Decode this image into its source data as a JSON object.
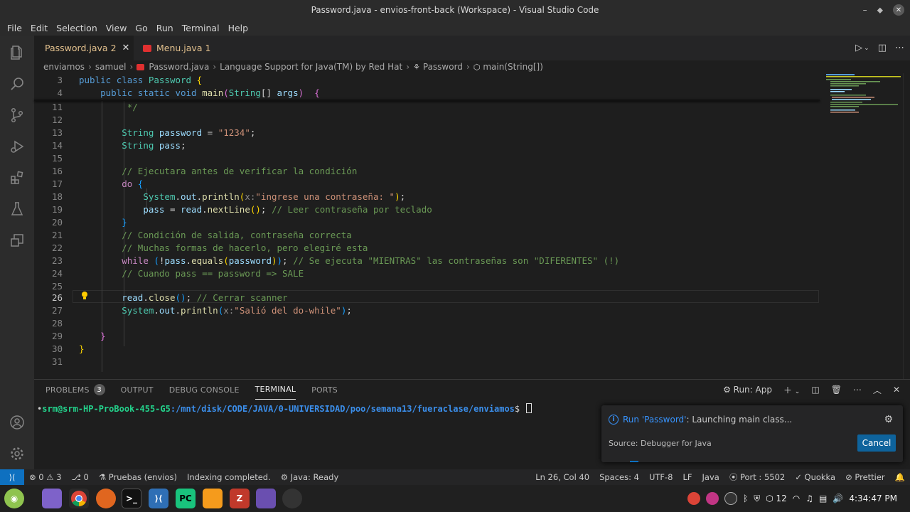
{
  "window": {
    "title": "Password.java - envios-front-back (Workspace) - Visual Studio Code",
    "minimize": "–",
    "restore": "⬥",
    "close": "✕"
  },
  "menu": [
    "File",
    "Edit",
    "Selection",
    "View",
    "Go",
    "Run",
    "Terminal",
    "Help"
  ],
  "tabs": [
    {
      "name": "Password.java",
      "count": "2",
      "close": "✕"
    },
    {
      "name": "Menu.java",
      "count": "1"
    }
  ],
  "breadcrumb": {
    "parts": [
      "enviamos",
      "samuel"
    ],
    "file": "Password.java",
    "provider": "Language Support for Java(TM) by Red Hat",
    "class": "Password",
    "method": "main(String[])"
  },
  "code_lines": [
    {
      "n": "3",
      "tokens": [
        [
          "kw",
          "public "
        ],
        [
          "kw",
          "class "
        ],
        [
          "ty",
          "Password "
        ],
        [
          "br",
          "{"
        ]
      ]
    },
    {
      "n": "4",
      "tokens": [
        [
          "",
          "    "
        ],
        [
          "kw",
          "public "
        ],
        [
          "kw",
          "static "
        ],
        [
          "kw",
          "void "
        ],
        [
          "fn",
          "main"
        ],
        [
          "br2",
          "("
        ],
        [
          "ty",
          "String"
        ],
        [
          "",
          "[] "
        ],
        [
          "vr",
          "args"
        ],
        [
          "br2",
          ")"
        ],
        [
          "",
          "  "
        ],
        [
          "br2",
          "{"
        ]
      ]
    },
    {
      "n": "11",
      "tokens": [
        [
          "cm",
          "         */"
        ]
      ]
    },
    {
      "n": "12",
      "tokens": []
    },
    {
      "n": "13",
      "tokens": [
        [
          "",
          "        "
        ],
        [
          "ty",
          "String "
        ],
        [
          "vr",
          "password"
        ],
        [
          "",
          " = "
        ],
        [
          "str",
          "\"1234\""
        ],
        [
          "",
          ";"
        ]
      ]
    },
    {
      "n": "14",
      "tokens": [
        [
          "",
          "        "
        ],
        [
          "ty",
          "String "
        ],
        [
          "vr",
          "pass"
        ],
        [
          "",
          ";"
        ]
      ]
    },
    {
      "n": "15",
      "tokens": []
    },
    {
      "n": "16",
      "tokens": [
        [
          "",
          "        "
        ],
        [
          "cm",
          "// Ejecutara antes de verificar la condición"
        ]
      ]
    },
    {
      "n": "17",
      "tokens": [
        [
          "",
          "        "
        ],
        [
          "kw2",
          "do "
        ],
        [
          "br3",
          "{"
        ]
      ]
    },
    {
      "n": "18",
      "tokens": [
        [
          "",
          "            "
        ],
        [
          "ty",
          "System"
        ],
        [
          "",
          "."
        ],
        [
          "vr",
          "out"
        ],
        [
          "",
          "."
        ],
        [
          "fn",
          "println"
        ],
        [
          "br",
          "("
        ],
        [
          "hint",
          "x:"
        ],
        [
          "str",
          "\"ingrese una contraseña: \""
        ],
        [
          "br",
          ")"
        ],
        [
          "",
          ";"
        ]
      ]
    },
    {
      "n": "19",
      "tokens": [
        [
          "",
          "            "
        ],
        [
          "vr",
          "pass"
        ],
        [
          "",
          " = "
        ],
        [
          "vr",
          "read"
        ],
        [
          "",
          "."
        ],
        [
          "fn",
          "nextLine"
        ],
        [
          "br",
          "()"
        ],
        [
          "",
          "; "
        ],
        [
          "cm",
          "// Leer contraseña por teclado"
        ]
      ]
    },
    {
      "n": "20",
      "tokens": [
        [
          "",
          "        "
        ],
        [
          "br3",
          "}"
        ]
      ]
    },
    {
      "n": "21",
      "tokens": [
        [
          "",
          "        "
        ],
        [
          "cm",
          "// Condición de salida, contraseña correcta"
        ]
      ]
    },
    {
      "n": "22",
      "tokens": [
        [
          "",
          "        "
        ],
        [
          "cm",
          "// Muchas formas de hacerlo, pero elegiré esta"
        ]
      ]
    },
    {
      "n": "23",
      "tokens": [
        [
          "",
          "        "
        ],
        [
          "kw2",
          "while "
        ],
        [
          "br3",
          "("
        ],
        [
          "",
          "!"
        ],
        [
          "vr",
          "pass"
        ],
        [
          "",
          "."
        ],
        [
          "fn",
          "equals"
        ],
        [
          "br",
          "("
        ],
        [
          "vr",
          "password"
        ],
        [
          "br",
          ")"
        ],
        [
          "br3",
          ")"
        ],
        [
          "",
          "; "
        ],
        [
          "cm",
          "// Se ejecuta \"MIENTRAS\" las contraseñas son \"DIFERENTES\" (!)"
        ]
      ]
    },
    {
      "n": "24",
      "tokens": [
        [
          "",
          "        "
        ],
        [
          "cm",
          "// Cuando pass == password => SALE"
        ]
      ]
    },
    {
      "n": "25",
      "tokens": []
    },
    {
      "n": "26",
      "tokens": [
        [
          "",
          "        "
        ],
        [
          "vr",
          "read"
        ],
        [
          "",
          "."
        ],
        [
          "fn",
          "close"
        ],
        [
          "br3",
          "()"
        ],
        [
          "",
          "; "
        ],
        [
          "cm",
          "// Cerrar scanner"
        ]
      ]
    },
    {
      "n": "27",
      "tokens": [
        [
          "",
          "        "
        ],
        [
          "ty",
          "System"
        ],
        [
          "",
          "."
        ],
        [
          "vr",
          "out"
        ],
        [
          "",
          "."
        ],
        [
          "fn",
          "println"
        ],
        [
          "br3",
          "("
        ],
        [
          "hint",
          "x:"
        ],
        [
          "str",
          "\"Salió del do-while\""
        ],
        [
          "br3",
          ")"
        ],
        [
          "",
          ";"
        ]
      ]
    },
    {
      "n": "28",
      "tokens": []
    },
    {
      "n": "29",
      "tokens": [
        [
          "",
          "    "
        ],
        [
          "br2",
          "}"
        ]
      ]
    },
    {
      "n": "30",
      "tokens": [
        [
          "br",
          "}"
        ]
      ]
    },
    {
      "n": "31",
      "tokens": []
    }
  ],
  "panel": {
    "tabs": [
      {
        "label": "PROBLEMS",
        "badge": "3"
      },
      {
        "label": "OUTPUT"
      },
      {
        "label": "DEBUG CONSOLE"
      },
      {
        "label": "TERMINAL"
      },
      {
        "label": "PORTS"
      }
    ],
    "run_config": "Run: App",
    "terminal": {
      "user": "srm@srm-HP-ProBook-455-G5",
      "path": ":/mnt/disk/CODE/JAVA/0-UNIVERSIDAD/poo/semana13/fueraclase/enviamos",
      "prompt": "$"
    }
  },
  "notification": {
    "prefix": "Run 'Password'",
    "message": ": Launching main class...",
    "source": "Source: Debugger for Java",
    "button": "Cancel"
  },
  "statusbar": {
    "remote": "⟩⟨",
    "errors": "0",
    "warnings": "3",
    "info": "0",
    "test": "Pruebas (envios)",
    "indexing": "Indexing completed.",
    "java": "Java: Ready",
    "position": "Ln 26, Col 40",
    "spaces": "Spaces: 4",
    "encoding": "UTF-8",
    "eol": "LF",
    "language": "Java",
    "port": "Port : 5502",
    "quokka": "Quokka",
    "prettier": "Prettier"
  },
  "taskbar": {
    "apps": [
      "PC",
      "Z"
    ],
    "tray_count": "12",
    "time": "4:34:47 PM"
  }
}
